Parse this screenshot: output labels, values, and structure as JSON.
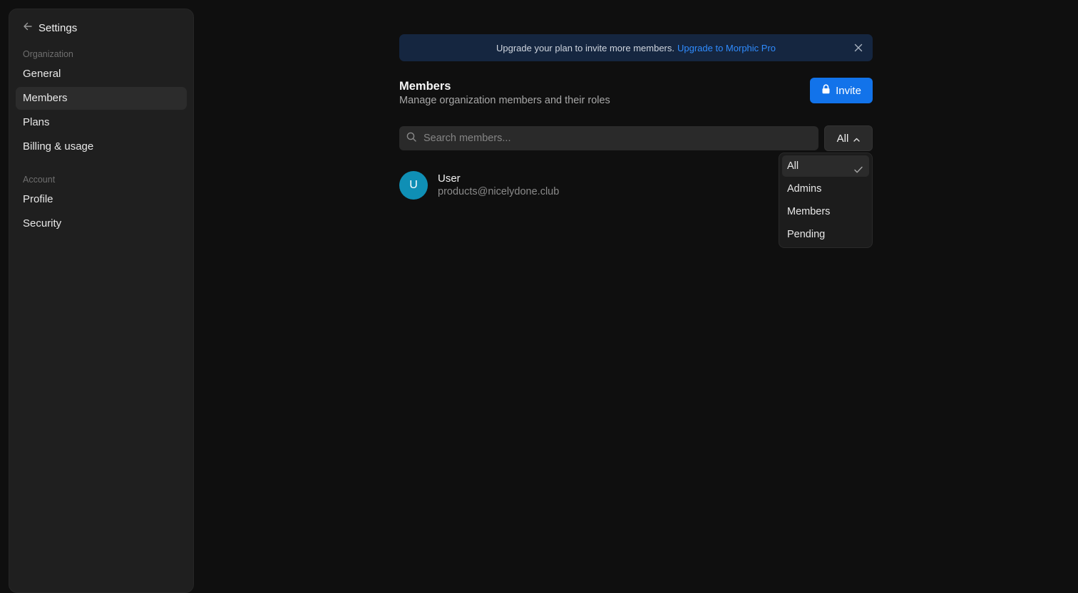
{
  "sidebar": {
    "back_label": "Settings",
    "sections": [
      {
        "title": "Organization",
        "items": [
          "General",
          "Members",
          "Plans",
          "Billing & usage"
        ]
      },
      {
        "title": "Account",
        "items": [
          "Profile",
          "Security"
        ]
      }
    ],
    "active_item": "Members"
  },
  "banner": {
    "text": "Upgrade your plan to invite more members.",
    "link": "Upgrade to Morphic Pro"
  },
  "page": {
    "title": "Members",
    "subtitle": "Manage organization members and their roles",
    "invite_label": "Invite"
  },
  "search": {
    "placeholder": "Search members...",
    "value": ""
  },
  "filter": {
    "selected": "All",
    "options": [
      "All",
      "Admins",
      "Members",
      "Pending"
    ]
  },
  "members": [
    {
      "initial": "U",
      "name": "User",
      "email": "products@nicelydone.club"
    }
  ],
  "colors": {
    "accent": "#1273ea",
    "link": "#2f8cff",
    "avatar": "#0f8fb5",
    "banner_bg": "#152640"
  },
  "icons": {
    "back": "arrow-left-icon",
    "close": "close-icon",
    "lock": "lock-icon",
    "search": "search-icon",
    "chevron": "chevron-up-icon",
    "check": "check-icon"
  }
}
